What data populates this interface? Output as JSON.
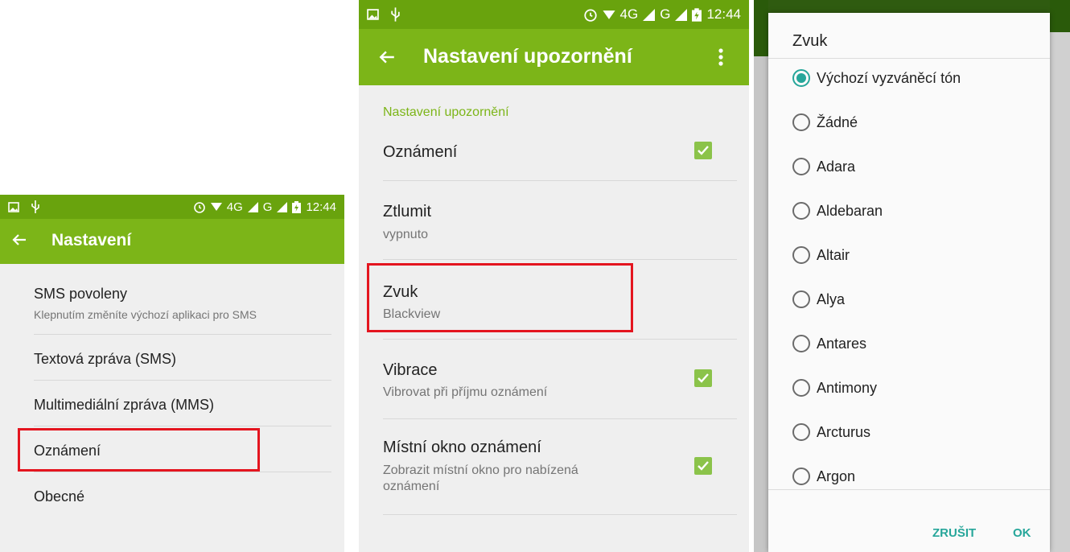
{
  "screen1": {
    "status": {
      "network": "4G",
      "network2": "G",
      "time": "12:44"
    },
    "appbar_title": "Nastavení",
    "items": [
      {
        "primary": "SMS povoleny",
        "secondary": "Klepnutím změníte výchozí aplikaci pro SMS"
      },
      {
        "primary": "Textová zpráva (SMS)"
      },
      {
        "primary": "Multimediální zpráva (MMS)"
      },
      {
        "primary": "Oznámení"
      },
      {
        "primary": "Obecné"
      }
    ]
  },
  "screen2": {
    "status": {
      "network": "4G",
      "network2": "G",
      "time": "12:44"
    },
    "appbar_title": "Nastavení upozornění",
    "section_header": "Nastavení upozornění",
    "items": [
      {
        "primary": "Oznámení",
        "checked": true
      },
      {
        "primary": "Ztlumit",
        "secondary": "vypnuto"
      },
      {
        "primary": "Zvuk",
        "secondary": "Blackview"
      },
      {
        "primary": "Vibrace",
        "secondary": "Vibrovat při příjmu oznámení",
        "checked": true
      },
      {
        "primary": "Místní okno oznámení",
        "secondary": "Zobrazit místní okno pro nabízená oznámení",
        "checked": true
      }
    ]
  },
  "dialog": {
    "title": "Zvuk",
    "options": [
      {
        "label": "Výchozí vyzváněcí tón",
        "selected": true
      },
      {
        "label": "Žádné",
        "selected": false
      },
      {
        "label": "Adara",
        "selected": false
      },
      {
        "label": "Aldebaran",
        "selected": false
      },
      {
        "label": "Altair",
        "selected": false
      },
      {
        "label": "Alya",
        "selected": false
      },
      {
        "label": "Antares",
        "selected": false
      },
      {
        "label": "Antimony",
        "selected": false
      },
      {
        "label": "Arcturus",
        "selected": false
      },
      {
        "label": "Argon",
        "selected": false
      }
    ],
    "cancel_label": "ZRUŠIT",
    "ok_label": "OK"
  },
  "colors": {
    "appbar": "#7cb518",
    "statusbar": "#69a30d",
    "accent": "#26a69a",
    "checkbox": "#8bc34a",
    "highlight": "#e4151f"
  }
}
